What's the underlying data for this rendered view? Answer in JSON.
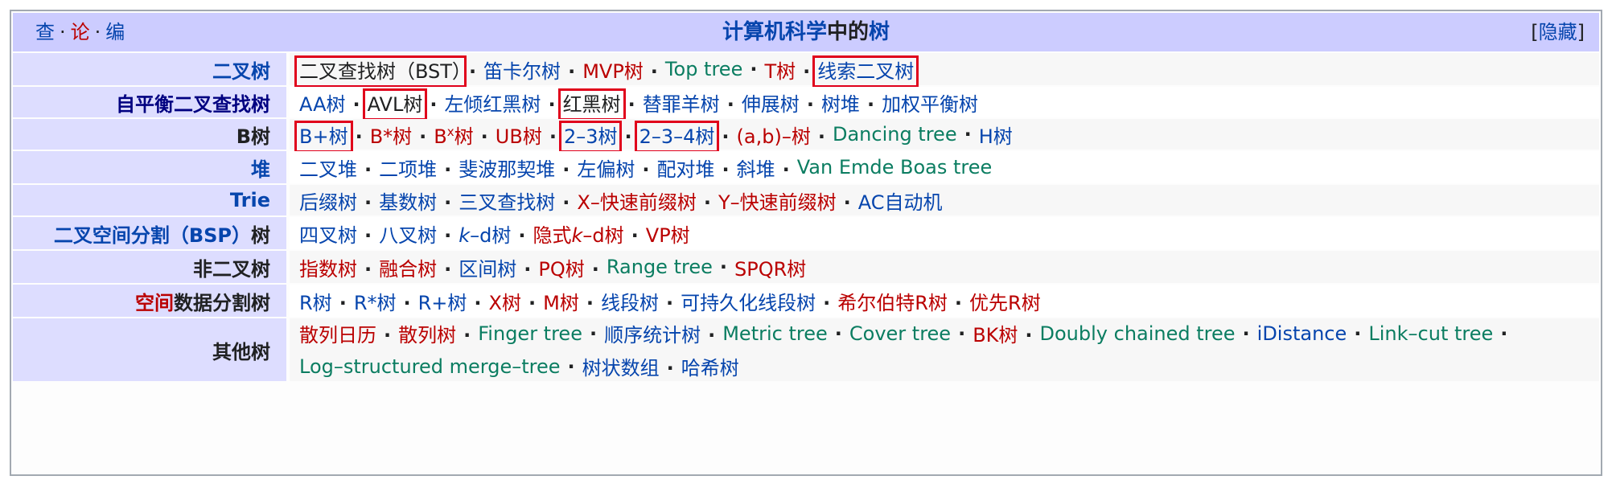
{
  "navbox": {
    "vte": {
      "view": "查",
      "talk": "论",
      "edit": "编",
      "sep": "·"
    },
    "title_link": "计算机科学",
    "title_text": "中的",
    "title_tail": "树",
    "hide_open": "[",
    "hide_label": "隐藏",
    "hide_close": "]"
  },
  "rows": [
    {
      "group": "二叉树",
      "group_color": "#0645ad",
      "group_underlined": true,
      "items": [
        {
          "text": "二叉查找树（BST）",
          "color": "dark",
          "boxed": true
        },
        {
          "text": "笛卡尔树",
          "color": "blue"
        },
        {
          "text": "MVP树",
          "color": "red"
        },
        {
          "text": "Top tree",
          "color": "green"
        },
        {
          "text": "T树",
          "color": "red"
        },
        {
          "text": "线索二叉树",
          "color": "blue",
          "boxed": true
        }
      ]
    },
    {
      "group": "自平衡二叉查找树",
      "group_color": "#000080",
      "group_underlined": true,
      "items": [
        {
          "text": "AA树",
          "color": "blue"
        },
        {
          "text": "AVL树",
          "color": "dark",
          "boxed": true
        },
        {
          "text": "左倾红黑树",
          "color": "blue"
        },
        {
          "text": "红黑树",
          "color": "dark",
          "boxed": true
        },
        {
          "text": "替罪羊树",
          "color": "blue"
        },
        {
          "text": "伸展树",
          "color": "blue"
        },
        {
          "text": "树堆",
          "color": "blue"
        },
        {
          "text": "加权平衡树",
          "color": "blue"
        }
      ]
    },
    {
      "group": "B树",
      "group_color": "#202122",
      "group_underlined": true,
      "items": [
        {
          "text": "B+树",
          "color": "blue",
          "boxed": true
        },
        {
          "text": "B*树",
          "color": "red"
        },
        {
          "text": "B",
          "sup": "x",
          "suffix": "树",
          "color": "red"
        },
        {
          "text": "UB树",
          "color": "red"
        },
        {
          "text": "2–3树",
          "color": "blue",
          "boxed": true
        },
        {
          "text": "2–3–4树",
          "color": "blue",
          "boxed": true
        },
        {
          "text": "(a,b)–树",
          "color": "red"
        },
        {
          "text": "Dancing tree",
          "color": "green"
        },
        {
          "text": "H树",
          "color": "blue"
        }
      ]
    },
    {
      "group": "堆",
      "group_color": "#0645ad",
      "items": [
        {
          "text": "二叉堆",
          "color": "blue"
        },
        {
          "text": "二项堆",
          "color": "blue"
        },
        {
          "text": "斐波那契堆",
          "color": "blue"
        },
        {
          "text": "左偏树",
          "color": "blue"
        },
        {
          "text": "配对堆",
          "color": "blue"
        },
        {
          "text": "斜堆",
          "color": "blue"
        },
        {
          "text": "Van Emde Boas tree",
          "color": "green"
        }
      ]
    },
    {
      "group": "Trie",
      "group_color": "#0645ad",
      "items": [
        {
          "text": "后缀树",
          "color": "blue"
        },
        {
          "text": "基数树",
          "color": "blue"
        },
        {
          "text": "三叉查找树",
          "color": "blue"
        },
        {
          "text": "X–快速前缀树",
          "color": "red"
        },
        {
          "text": "Y–快速前缀树",
          "color": "red"
        },
        {
          "text": "AC自动机",
          "color": "blue"
        }
      ]
    },
    {
      "group": "二叉空间分割（BSP）树",
      "group_color": "#0645ad",
      "group_split": {
        "link": "二叉空间分割（BSP）",
        "rest": "树"
      },
      "items": [
        {
          "text": "四叉树",
          "color": "blue"
        },
        {
          "text": "八叉树",
          "color": "blue"
        },
        {
          "text": "k–d树",
          "color": "blue",
          "italic_prefix": "k"
        },
        {
          "text": "隐式k–d树",
          "color": "red",
          "italic_mid": true
        },
        {
          "text": "VP树",
          "color": "red"
        }
      ]
    },
    {
      "group": "非二叉树",
      "group_color": "#202122",
      "items": [
        {
          "text": "指数树",
          "color": "red"
        },
        {
          "text": "融合树",
          "color": "red"
        },
        {
          "text": "区间树",
          "color": "blue"
        },
        {
          "text": "PQ树",
          "color": "red"
        },
        {
          "text": "Range tree",
          "color": "green"
        },
        {
          "text": "SPQR树",
          "color": "red"
        }
      ]
    },
    {
      "group": "空间数据分割树",
      "group_color": "#202122",
      "group_split_red": {
        "link": "空间",
        "rest": "数据分割树"
      },
      "items": [
        {
          "text": "R树",
          "color": "blue"
        },
        {
          "text": "R*树",
          "color": "blue"
        },
        {
          "text": "R+树",
          "color": "blue"
        },
        {
          "text": "X树",
          "color": "red"
        },
        {
          "text": "M树",
          "color": "red"
        },
        {
          "text": "线段树",
          "color": "blue"
        },
        {
          "text": "可持久化线段树",
          "color": "blue"
        },
        {
          "text": "希尔伯特R树",
          "color": "red"
        },
        {
          "text": "优先R树",
          "color": "red"
        }
      ]
    },
    {
      "group": "其他树",
      "group_color": "#202122",
      "items": [
        {
          "text": "散列日历",
          "color": "red"
        },
        {
          "text": "散列树",
          "color": "red"
        },
        {
          "text": "Finger tree",
          "color": "green"
        },
        {
          "text": "顺序统计树",
          "color": "blue"
        },
        {
          "text": "Metric tree",
          "color": "green"
        },
        {
          "text": "Cover tree",
          "color": "green"
        },
        {
          "text": "BK树",
          "color": "red"
        },
        {
          "text": "Doubly chained tree",
          "color": "green"
        },
        {
          "text": "iDistance",
          "color": "blue"
        },
        {
          "text": "Link–cut tree",
          "color": "green"
        },
        {
          "text": "Log–structured merge–tree",
          "color": "green"
        },
        {
          "text": "树状数组",
          "color": "blue"
        },
        {
          "text": "哈希树",
          "color": "blue"
        }
      ]
    }
  ],
  "colors": {
    "link": "#0645ad",
    "redlink": "#ba0000",
    "extlink": "#0b7d61",
    "highlight": "#e0001b",
    "titlebar": "#ccccff",
    "groupcell": "#ddddff"
  }
}
